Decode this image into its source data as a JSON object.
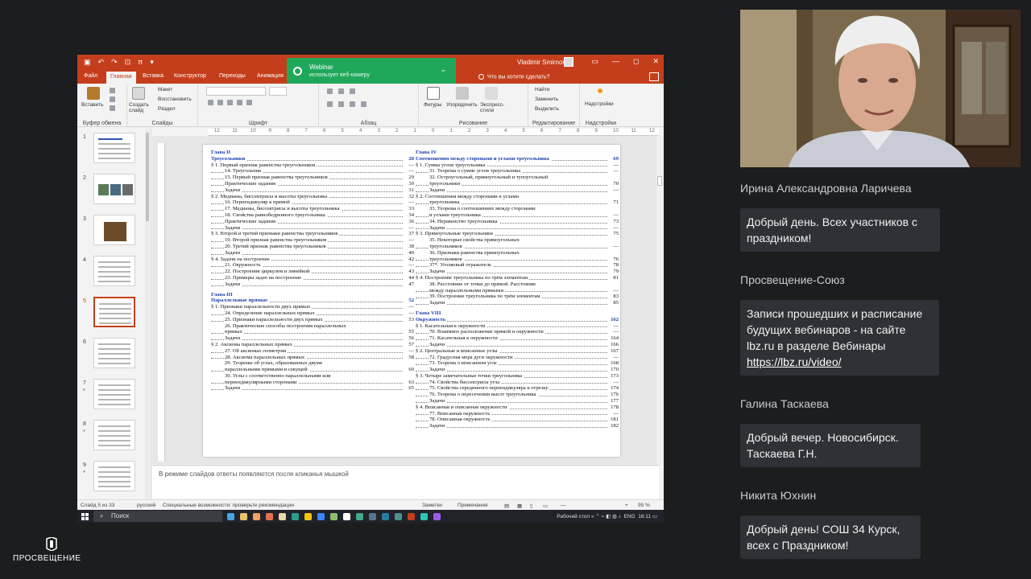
{
  "ppt": {
    "user_name": "Vladimir Smirnov",
    "tabs": [
      "Файл",
      "Главная",
      "Вставка",
      "Конструктор",
      "Переходы",
      "Анимация"
    ],
    "active_tab": "Главная",
    "tell_me": "Что вы хотите сделать?",
    "toast": {
      "title": "Webinar",
      "subtitle": "использует веб-камеру"
    },
    "ribbon": {
      "paste": "Вставить",
      "clipboard": "Буфер обмена",
      "new_slide": "Создать слайд",
      "layout": "Макет",
      "reset": "Восстановить",
      "section": "Раздел",
      "slides": "Слайды",
      "font": "Шрифт",
      "paragraph": "Абзац",
      "shapes": "Фигуры",
      "arrange": "Упорядочить",
      "quick_styles": "Экспресс-стили",
      "drawing": "Рисование",
      "find": "Найти",
      "replace": "Заменить",
      "select": "Выделить",
      "editing": "Редактирование",
      "addins": "Надстройки",
      "addins_group": "Надстройки"
    },
    "ruler": [
      "12",
      "11",
      "10",
      "9",
      "8",
      "7",
      "6",
      "5",
      "4",
      "3",
      "2",
      "1",
      "0",
      "1",
      "2",
      "3",
      "4",
      "5",
      "6",
      "7",
      "8",
      "9",
      "10",
      "11",
      "12"
    ],
    "thumbs": [
      {
        "num": "1",
        "star": ""
      },
      {
        "num": "2",
        "star": ""
      },
      {
        "num": "3",
        "star": ""
      },
      {
        "num": "4",
        "star": ""
      },
      {
        "num": "5",
        "star": ""
      },
      {
        "num": "6",
        "star": ""
      },
      {
        "num": "7",
        "star": "*"
      },
      {
        "num": "8",
        "star": "*"
      },
      {
        "num": "9",
        "star": "*"
      }
    ],
    "selected_thumb": "5",
    "notes": "В режиме слайдов ответы появляются после кликанья мышкой",
    "status": {
      "slide": "Слайд 5 из 33",
      "lang": "русский",
      "accessibility": "Специальные возможности: проверьте рекомендации",
      "notes_btn": "Заметки",
      "comments_btn": "Примечания",
      "zoom": "95 %"
    },
    "taskbar": {
      "search": "Поиск",
      "desktop": "Рабочий стол",
      "lang": "ENG",
      "time": "16:11"
    }
  },
  "toc_left": [
    {
      "t": "Глава II",
      "p": "",
      "k": "h"
    },
    {
      "t": "Треугольники",
      "p": "28",
      "k": "h"
    },
    {
      "t": "§ 1. Первый признак равенства треугольников",
      "p": "—",
      "k": "l1"
    },
    {
      "t": "14. Треугольник",
      "p": "—",
      "k": "l2"
    },
    {
      "t": "15. Первый признак равенства треугольников",
      "p": "29",
      "k": "l2"
    },
    {
      "t": "Практические задания",
      "p": "30",
      "k": "l2"
    },
    {
      "t": "Задачи",
      "p": "31",
      "k": "l2"
    },
    {
      "t": "§ 2. Медианы, биссектрисы и высоты треугольника",
      "p": "32",
      "k": "l1"
    },
    {
      "t": "16. Перпендикуляр к прямой",
      "p": "—",
      "k": "l2"
    },
    {
      "t": "17. Медианы, биссектрисы и высоты треугольника",
      "p": "33",
      "k": "l2"
    },
    {
      "t": "18. Свойства равнобедренного треугольника",
      "p": "34",
      "k": "l2"
    },
    {
      "t": "Практические задания",
      "p": "36",
      "k": "l2"
    },
    {
      "t": "Задачи",
      "p": "—",
      "k": "l2"
    },
    {
      "t": "§ 3. Второй и третий признаки равенства треугольников",
      "p": "37",
      "k": "l1"
    },
    {
      "t": "19. Второй признак равенства треугольников",
      "p": "—",
      "k": "l2"
    },
    {
      "t": "20. Третий признак равенства треугольников",
      "p": "38",
      "k": "l2"
    },
    {
      "t": "Задачи",
      "p": "40",
      "k": "l2"
    },
    {
      "t": "§ 4. Задачи на построение",
      "p": "42",
      "k": "l1"
    },
    {
      "t": "21. Окружность",
      "p": "—",
      "k": "l2"
    },
    {
      "t": "22. Построения циркулем и линейкой",
      "p": "43",
      "k": "l2"
    },
    {
      "t": "23. Примеры задач на построение",
      "p": "44",
      "k": "l2"
    },
    {
      "t": "Задачи",
      "p": "47",
      "k": "l2"
    },
    {
      "t": "",
      "p": "",
      "k": "sp"
    },
    {
      "t": "Глава III",
      "p": "",
      "k": "h"
    },
    {
      "t": "Параллельные прямые",
      "p": "52",
      "k": "h"
    },
    {
      "t": "§ 1. Признаки параллельности двух прямых",
      "p": "—",
      "k": "l1"
    },
    {
      "t": "24. Определение параллельных прямых",
      "p": "—",
      "k": "l2"
    },
    {
      "t": "25. Признаки параллельности двух прямых",
      "p": "53",
      "k": "l2"
    },
    {
      "t": "26. Практические способы построения параллельных",
      "p": "",
      "k": "l2"
    },
    {
      "t": "прямых",
      "p": "55",
      "k": "l2"
    },
    {
      "t": "Задачи",
      "p": "56",
      "k": "l2"
    },
    {
      "t": "§ 2. Аксиома параллельных прямых",
      "p": "57",
      "k": "l1"
    },
    {
      "t": "27. Об аксиомах геометрии",
      "p": "—",
      "k": "l2"
    },
    {
      "t": "28. Аксиома параллельных прямых",
      "p": "58",
      "k": "l2"
    },
    {
      "t": "29. Теоремы об углах, образованных двумя",
      "p": "",
      "k": "l2"
    },
    {
      "t": "параллельными прямыми и секущей",
      "p": "60",
      "k": "l2"
    },
    {
      "t": "30. Углы с соответственно параллельными или",
      "p": "",
      "k": "l2"
    },
    {
      "t": "перпендикулярными сторонами",
      "p": "63",
      "k": "l2"
    },
    {
      "t": "Задачи",
      "p": "65",
      "k": "l2"
    }
  ],
  "toc_right": [
    {
      "t": "Глава IV",
      "p": "",
      "k": "h"
    },
    {
      "t": "Соотношения между сторонами и углами треугольника",
      "p": "69",
      "k": "h"
    },
    {
      "t": "§ 1. Сумма углов треугольника",
      "p": "—",
      "k": "l1"
    },
    {
      "t": "31. Теорема о сумме углов треугольника",
      "p": "—",
      "k": "l2"
    },
    {
      "t": "32. Остроугольный, прямоугольный и тупоугольный",
      "p": "",
      "k": "l2"
    },
    {
      "t": "треугольники",
      "p": "70",
      "k": "l2"
    },
    {
      "t": "Задачи",
      "p": "—",
      "k": "l2"
    },
    {
      "t": "§ 2. Соотношения между сторонами и углами",
      "p": "",
      "k": "l1"
    },
    {
      "t": "треугольника",
      "p": "71",
      "k": "l2"
    },
    {
      "t": "33. Теорема о соотношениях между сторонами",
      "p": "",
      "k": "l2"
    },
    {
      "t": "и углами треугольника",
      "p": "—",
      "k": "l2"
    },
    {
      "t": "34. Неравенство треугольника",
      "p": "73",
      "k": "l2"
    },
    {
      "t": "Задачи",
      "p": "—",
      "k": "l2"
    },
    {
      "t": "§ 3. Прямоугольные треугольники",
      "p": "75",
      "k": "l1"
    },
    {
      "t": "35. Некоторые свойства прямоугольных",
      "p": "",
      "k": "l2"
    },
    {
      "t": "треугольников",
      "p": "—",
      "k": "l2"
    },
    {
      "t": "36. Признаки равенства прямоугольных",
      "p": "",
      "k": "l2"
    },
    {
      "t": "треугольников",
      "p": "76",
      "k": "l2"
    },
    {
      "t": "37*. Уголковый отражатель",
      "p": "78",
      "k": "l2"
    },
    {
      "t": "Задачи",
      "p": "79",
      "k": "l2"
    },
    {
      "t": "§ 4. Построение треугольника по трём элементам",
      "p": "81",
      "k": "l1"
    },
    {
      "t": "38. Расстояние от точки до прямой. Расстояние",
      "p": "",
      "k": "l2"
    },
    {
      "t": "между параллельными прямыми",
      "p": "—",
      "k": "l2"
    },
    {
      "t": "39. Построение треугольника по трём элементам",
      "p": "83",
      "k": "l2"
    },
    {
      "t": "Задачи",
      "p": "85",
      "k": "l2"
    },
    {
      "t": "",
      "p": "",
      "k": "sp"
    },
    {
      "t": "Глава VIII",
      "p": "",
      "k": "h"
    },
    {
      "t": "Окружность",
      "p": "162",
      "k": "h"
    },
    {
      "t": "§ 1. Касательная к окружности",
      "p": "—",
      "k": "l1"
    },
    {
      "t": "70. Взаимное расположение прямой и окружности",
      "p": "—",
      "k": "l2"
    },
    {
      "t": "71. Касательная к окружности",
      "p": "164",
      "k": "l2"
    },
    {
      "t": "Задачи",
      "p": "166",
      "k": "l2"
    },
    {
      "t": "§ 2. Центральные и вписанные углы",
      "p": "167",
      "k": "l1"
    },
    {
      "t": "72. Градусная мера дуги окружности",
      "p": "—",
      "k": "l2"
    },
    {
      "t": "73. Теорема о вписанном угле",
      "p": "168",
      "k": "l2"
    },
    {
      "t": "Задачи",
      "p": "170",
      "k": "l2"
    },
    {
      "t": "§ 3. Четыре замечательные точки треугольника",
      "p": "173",
      "k": "l1"
    },
    {
      "t": "74. Свойства биссектрисы угла",
      "p": "—",
      "k": "l2"
    },
    {
      "t": "75. Свойства серединного перпендикуляра к отрезку",
      "p": "174",
      "k": "l2"
    },
    {
      "t": "76. Теорема о пересечении высот треугольника",
      "p": "176",
      "k": "l2"
    },
    {
      "t": "Задачи",
      "p": "177",
      "k": "l2"
    },
    {
      "t": "§ 4. Вписанная и описанная окружности",
      "p": "178",
      "k": "l1"
    },
    {
      "t": "77. Вписанная окружность",
      "p": "—",
      "k": "l2"
    },
    {
      "t": "78. Описанная окружность",
      "p": "181",
      "k": "l2"
    },
    {
      "t": "Задачи",
      "p": "182",
      "k": "l2"
    }
  ],
  "chat": [
    {
      "name": "Ирина Александровна Ларичева",
      "text": "Добрый день. Всех участников с праздником!"
    },
    {
      "name": "Просвещение-Союз",
      "text": "Записи прошедших и расписание будущих вебинаров - на сайте  lbz.ru  в разделе Вебинары ",
      "link": "https://lbz.ru/video/"
    },
    {
      "name": "Галина Таскаева",
      "text": "Добрый вечер. Новосибирск. Таскаева Г.Н."
    },
    {
      "name": "Никита Юхнин",
      "text": "Добрый день! СОШ 34 Курск, всех с Праздником!"
    }
  ],
  "logo": {
    "text": "ПРОСВЕЩЕНИЕ"
  },
  "colors": {
    "accent": "#c43e1c",
    "toast": "#20a85a",
    "heading": "#1a3fa6",
    "chat_bg": "#2e3136"
  }
}
